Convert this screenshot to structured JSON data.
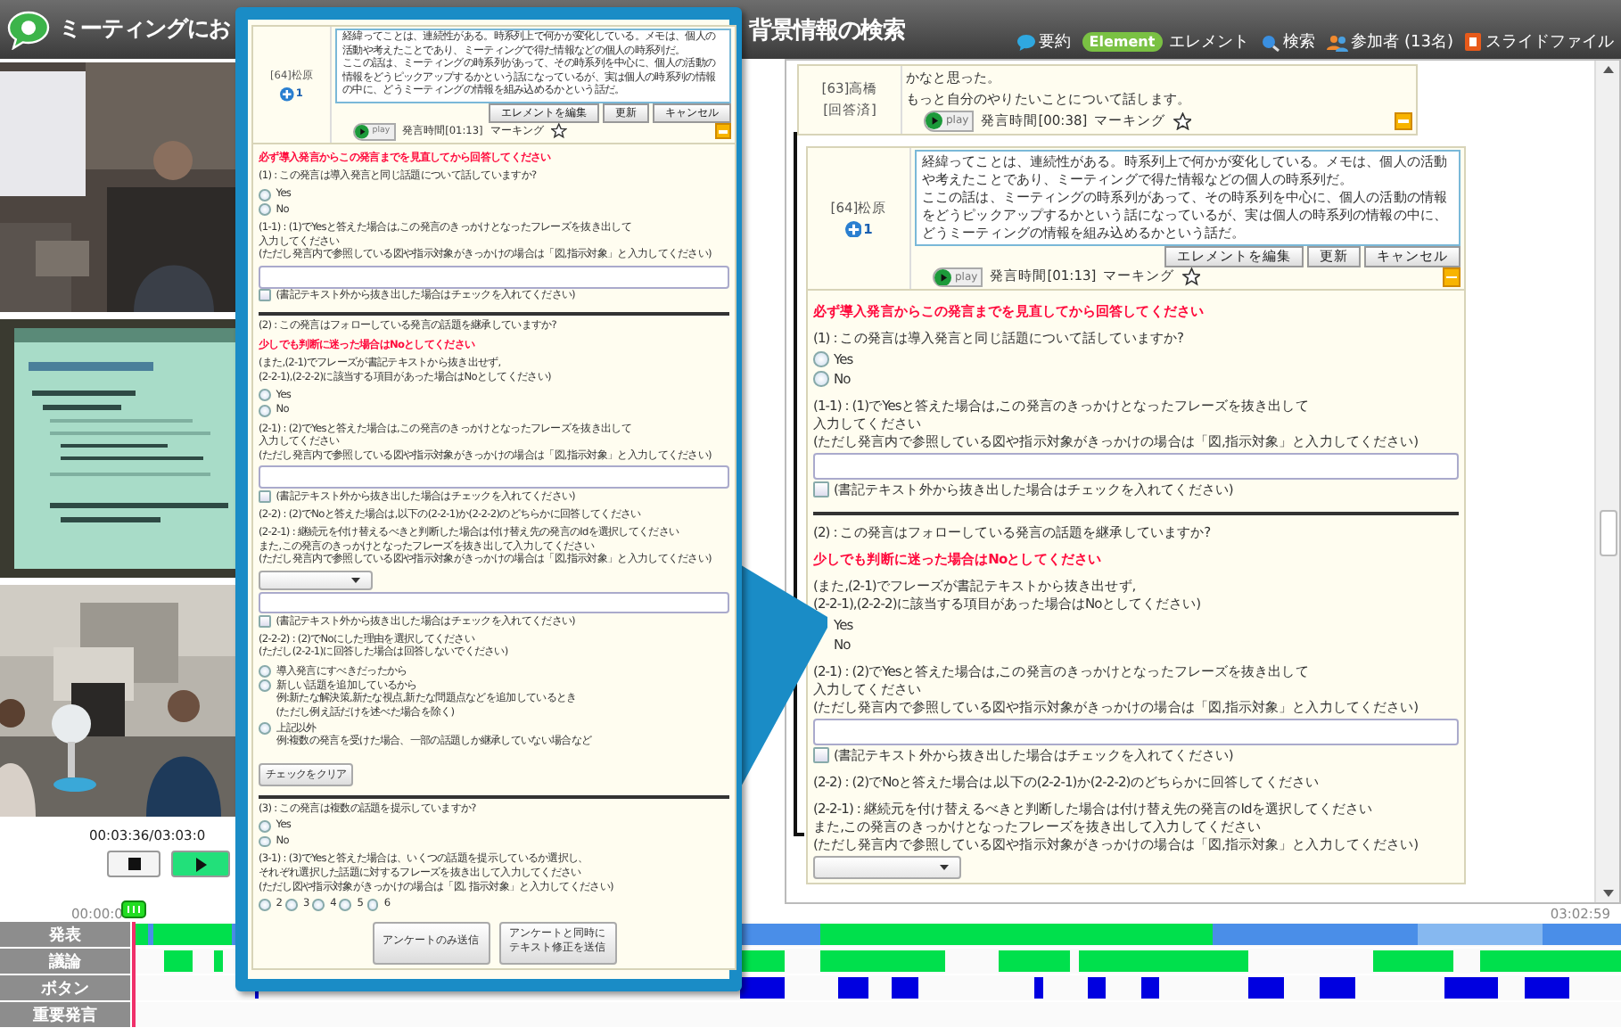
{
  "title_bar": {
    "title_start": "ミーティングにお",
    "title_end": "背景情報の検索",
    "links": [
      {
        "kind": "summary",
        "label": "要約"
      },
      {
        "kind": "element",
        "badge": "Element",
        "label": "エレメント"
      },
      {
        "kind": "search",
        "label": "検索"
      },
      {
        "kind": "participants",
        "label": "参加者 (13名)"
      },
      {
        "kind": "slides",
        "label": "スライドファイル"
      }
    ]
  },
  "player": {
    "time": "00:03:36/03:03:0",
    "buttons": [
      {
        "kind": "stop"
      },
      {
        "kind": "play"
      }
    ]
  },
  "timeline": {
    "start": "00:00:0",
    "end": "03:02:59",
    "rows": [
      {
        "label": "発表"
      },
      {
        "label": "議論"
      },
      {
        "label": "ボタン"
      },
      {
        "label": "重要発言"
      }
    ]
  },
  "main_panel": {
    "previous": {
      "speaker": "[63]高橋",
      "status": "[回答済]",
      "paragraphs": [
        "かなと思った。",
        "もっと自分のやりたいことについて話します。"
      ],
      "play_label": "play",
      "time": "発言時間[00:38]",
      "marking": "マーキング"
    },
    "current": {
      "speaker": "[64]松原",
      "count": "1",
      "paragraphs": [
        "経緯ってことは、連続性がある。時系列上で何かが変化している。メモは、個人の活動や考えたことであり、ミーティングで得た情報などの個人の時系列だ。",
        "ここの話は、ミーティングの時系列があって、その時系列を中心に、個人の活動の情報をどうピックアップするかという話になっているが、実は個人の時系列の情報の中に、どうミーティングの情報を組み込めるかという話だ。"
      ],
      "buttons": [
        "エレメントを編集",
        "更新",
        "キャンセル"
      ],
      "play_label": "play",
      "time": "発言時間[01:13]",
      "marking": "マーキング"
    },
    "form": [
      {
        "kind": "notice",
        "text": "必ず導入発言からこの発言までを見直してから回答してください"
      },
      {
        "kind": "text",
        "lines": [
          "(1) : この発言は導入発言と同じ話題について話していますか?"
        ]
      },
      {
        "kind": "radio",
        "options": [
          {
            "label": "Yes",
            "selected": false
          },
          {
            "label": "No",
            "selected": false
          }
        ]
      },
      {
        "kind": "text",
        "lines": [
          "(1-1) : (1)でYesと答えた場合は,この発言のきっかけとなったフレーズを抜き出して",
          "入力してください",
          "(ただし発言内で参照している図や指示対象がきっかけの場合は「図,指示対象」と入力してください)"
        ]
      },
      {
        "kind": "input"
      },
      {
        "kind": "checkbox",
        "label": "(書記テキスト外から抜き出した場合はチェックを入れてください)",
        "checked": false
      },
      {
        "kind": "divider"
      },
      {
        "kind": "text",
        "lines": [
          "(2) : この発言はフォローしている発言の話題を継承していますか?"
        ]
      },
      {
        "kind": "notice",
        "text": "少しでも判断に迷った場合はNoとしてください"
      },
      {
        "kind": "text",
        "lines": [
          "(また,(2-1)でフレーズが書記テキストから抜き出せず,",
          "(2-2-1),(2-2-2)に該当する項目があった場合はNoとしてください)"
        ]
      },
      {
        "kind": "radio",
        "options": [
          {
            "label": "Yes"
          },
          {
            "label": "No"
          }
        ]
      },
      {
        "kind": "text",
        "lines": [
          "(2-1) : (2)でYesと答えた場合は,この発言のきっかけとなったフレーズを抜き出して",
          "入力してください",
          "(ただし発言内で参照している図や指示対象がきっかけの場合は「図,指示対象」と入力してください)"
        ]
      },
      {
        "kind": "input"
      },
      {
        "kind": "checkbox",
        "label": "(書記テキスト外から抜き出した場合はチェックを入れてください)",
        "checked": false
      },
      {
        "kind": "text",
        "lines": [
          "(2-2) : (2)でNoと答えた場合は,以下の(2-2-1)か(2-2-2)のどちらかに回答してください"
        ]
      },
      {
        "kind": "text",
        "lines": [
          "(2-2-1) : 継続元を付け替えるべきと判断した場合は付け替え先の発言のIdを選択してください",
          "また,この発言のきっかけとなったフレーズを抜き出して入力してください",
          "(ただし発言内で参照している図や指示対象がきっかけの場合は「図,指示対象」と入力してください)"
        ]
      },
      {
        "kind": "select"
      }
    ]
  },
  "popup": {
    "current": {
      "speaker": "[64]松原",
      "count": "1",
      "paragraphs": [
        "経緯ってことは、連続性がある。時系列上で何かが変化している。メモは、個人の活動や考えたことであり、ミーティングで得た情報などの個人の時系列だ。",
        "ここの話は、ミーティングの時系列があって、その時系列を中心に、個人の活動の情報をどうピックアップするかという話になっているが、実は個人の時系列の情報の中に、どうミーティングの情報を組み込めるかという話だ。"
      ],
      "buttons": [
        "エレメントを編集",
        "更新",
        "キャンセル"
      ],
      "play_label": "play",
      "time": "発言時間[01:13]",
      "marking": "マーキング"
    },
    "form": [
      {
        "kind": "notice",
        "text": "必ず導入発言からこの発言までを見直してから回答してください"
      },
      {
        "kind": "text",
        "lines": [
          "(1) : この発言は導入発言と同じ話題について話していますか?"
        ]
      },
      {
        "kind": "radio",
        "options": [
          {
            "label": "Yes",
            "selected": false
          },
          {
            "label": "No",
            "selected": false
          }
        ]
      },
      {
        "kind": "text",
        "lines": [
          "(1-1) : (1)でYesと答えた場合は,この発言のきっかけとなったフレーズを抜き出して",
          "入力してください",
          "(ただし発言内で参照している図や指示対象がきっかけの場合は「図,指示対象」と入力してください)"
        ]
      },
      {
        "kind": "input"
      },
      {
        "kind": "checkbox",
        "label": "(書記テキスト外から抜き出した場合はチェックを入れてください)",
        "checked": false
      },
      {
        "kind": "divider"
      },
      {
        "kind": "text",
        "lines": [
          "(2) : この発言はフォローしている発言の話題を継承していますか?"
        ]
      },
      {
        "kind": "notice",
        "text": "少しでも判断に迷った場合はNoとしてください"
      },
      {
        "kind": "text",
        "lines": [
          "(また,(2-1)でフレーズが書記テキストから抜き出せず,",
          "(2-2-1),(2-2-2)に該当する項目があった場合はNoとしてください)"
        ]
      },
      {
        "kind": "radio",
        "options": [
          {
            "label": "Yes",
            "selected": false
          },
          {
            "label": "No",
            "selected": false
          }
        ]
      },
      {
        "kind": "text",
        "lines": [
          "(2-1) : (2)でYesと答えた場合は,この発言のきっかけとなったフレーズを抜き出して",
          "入力してください",
          "(ただし発言内で参照している図や指示対象がきっかけの場合は「図,指示対象」と入力してください)"
        ]
      },
      {
        "kind": "input"
      },
      {
        "kind": "checkbox",
        "label": "(書記テキスト外から抜き出した場合はチェックを入れてください)",
        "checked": false
      },
      {
        "kind": "text",
        "lines": [
          "(2-2) : (2)でNoと答えた場合は,以下の(2-2-1)か(2-2-2)のどちらかに回答してください"
        ]
      },
      {
        "kind": "text",
        "lines": [
          "(2-2-1) : 継続元を付け替えるべきと判断した場合は付け替え先の発言のIdを選択してください",
          "また,この発言のきっかけとなったフレーズを抜き出して入力してください",
          "(ただし発言内で参照している図や指示対象がきっかけの場合は「図,指示対象」と入力してください)"
        ]
      },
      {
        "kind": "select"
      },
      {
        "kind": "input"
      },
      {
        "kind": "checkbox",
        "label": "(書記テキスト外から抜き出した場合はチェックを入れてください)",
        "checked": false
      },
      {
        "kind": "text",
        "lines": [
          "(2-2-2) : (2)でNoにした理由を選択してください",
          "(ただし(2-2-1)に回答した場合は回答しないでください)"
        ]
      },
      {
        "kind": "radio",
        "options": [
          {
            "label": "導入発言にすべきだったから",
            "selected": false
          },
          {
            "label": "新しい話題を追加しているから",
            "selected": false,
            "notes": [
              "例:新たな解決策,新たな視点,新たな問題点などを追加しているとき",
              "(ただし例え話だけを述べた場合を除く)"
            ]
          },
          {
            "label": "上記以外",
            "selected": false,
            "notes": [
              "例:複数の発言を受けた場合、一部の話題しか継承していない場合など"
            ]
          }
        ]
      },
      {
        "kind": "button",
        "label": "チェックをクリア"
      },
      {
        "kind": "divider"
      },
      {
        "kind": "text",
        "lines": [
          "(3) : この発言は複数の話題を提示していますか?"
        ]
      },
      {
        "kind": "radio",
        "options": [
          {
            "label": "Yes",
            "selected": false
          },
          {
            "label": "No",
            "selected": false
          }
        ]
      },
      {
        "kind": "text",
        "lines": [
          "(3-1) : (3)でYesと答えた場合は、いくつの話題を提示しているか選択し、",
          "それぞれ選択した話題に対するフレーズを抜き出して入力してください",
          "(ただし図や指示対象がきっかけの場合は「図, 指示対象」と入力してください)"
        ]
      },
      {
        "kind": "radio_inline",
        "options": [
          {
            "label": "2",
            "selected": false
          },
          {
            "label": "3",
            "selected": false
          },
          {
            "label": "4",
            "selected": false
          },
          {
            "label": "5",
            "selected": false
          },
          {
            "label": "6",
            "selected": false
          }
        ]
      },
      {
        "kind": "submit",
        "buttons": [
          {
            "lines": [
              "アンケートのみ送信"
            ]
          },
          {
            "lines": [
              "アンケートと同時に",
              "テキスト修正を送信"
            ]
          }
        ]
      }
    ]
  }
}
